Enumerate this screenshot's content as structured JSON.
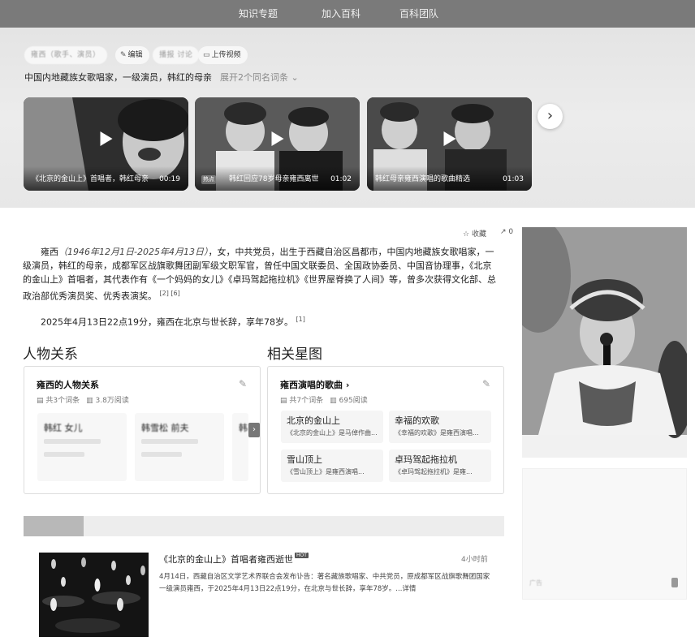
{
  "nav": {
    "items": [
      "知识专题",
      "加入百科",
      "百科团队"
    ]
  },
  "header": {
    "blurred_name": "雍西（歌手、演员）",
    "blurred_tag": "播报 讨论",
    "edit_label": "编辑",
    "upload_video_label": "上传视频",
    "summary": "中国内地藏族女歌唱家，一级演员，韩红的母亲",
    "expand_label": "展开2个同名词条"
  },
  "videos": [
    {
      "title": "《北京的金山上》首唱者，韩红母亲",
      "duration": "00:19"
    },
    {
      "title": "韩红回应78岁母亲雍西离世",
      "duration": "01:02",
      "badge": "热点"
    },
    {
      "title": "韩红母亲雍西演唱的歌曲精选",
      "duration": "01:03"
    }
  ],
  "actions": {
    "collect_label": "收藏",
    "share_count": "0"
  },
  "intro": {
    "lead_name": "雍西",
    "dates": "（1946年12月1日-2025年4月13日）",
    "body": "，女，中共党员，出生于西藏自治区昌都市，中国内地藏族女歌唱家，一级演员，韩红的母亲，成都军区战旗歌舞团副军级文职军官，曾任中国文联委员、全国政协委员、中国音协理事，《北京的金山上》首唱者，其代表作有《一个妈妈的女儿》《卓玛驾起拖拉机》《世界屋脊换了人间》等，曾多次获得文化部、总政治部优秀演员奖、优秀表演奖。",
    "refs": "[2]  [6]",
    "death": "2025年4月13日22点19分，雍西在北京与世长辞，享年78岁。",
    "death_ref": "[1]"
  },
  "relations": {
    "section_title": "人物关系",
    "box_title": "雍西的人物关系",
    "entries": "共3个词条",
    "reads": "3.8万阅读",
    "cards": [
      {
        "name": "韩红  女儿"
      },
      {
        "name": "韩雪松  前夫"
      },
      {
        "name": "韩"
      }
    ]
  },
  "songs": {
    "section_title": "相关星图",
    "box_title": "雍西演唱的歌曲",
    "entries": "共7个词条",
    "reads": "695阅读",
    "items": [
      {
        "title": "北京的金山上",
        "desc": "《北京的金山上》是马倬作曲..."
      },
      {
        "title": "幸福的欢歌",
        "desc": "《幸福的欢歌》是雍西演唱..."
      },
      {
        "title": "雪山顶上",
        "desc": "《雪山顶上》是雍西演唱..."
      },
      {
        "title": "卓玛驾起拖拉机",
        "desc": "《卓玛驾起拖拉机》是雍..."
      }
    ]
  },
  "news": {
    "title": "《北京的金山上》首唱者雍西逝世",
    "badge": "HOT",
    "time": "4小时前",
    "desc": "4月14日，西藏自治区文学艺术界联合会发布讣告：著名藏族歌唱家、中共党员，原成都军区战旗歌舞团国家一级演员雍西，于2025年4月13日22点19分，在北京与世长辞，享年78岁。...详情"
  },
  "ad": {
    "text": "广告"
  },
  "colors": {
    "nav_bg": "#7a7a7a",
    "hero_bg": "#e7e7e7",
    "card_bg": "#f5f5f5"
  }
}
